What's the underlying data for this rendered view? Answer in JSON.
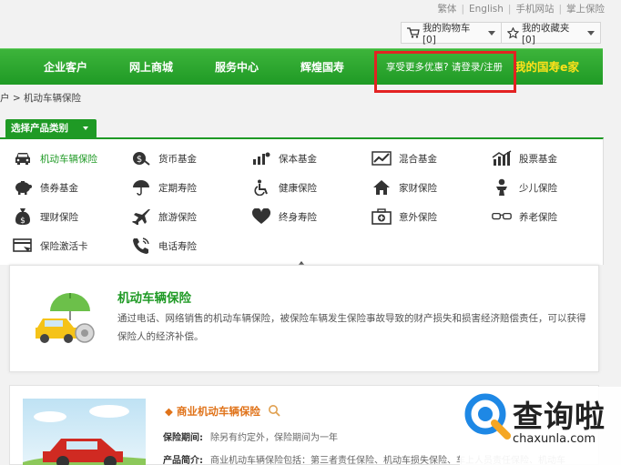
{
  "top_links": [
    "繁体",
    "English",
    "手机网站",
    "掌上保险"
  ],
  "cart": {
    "label": "我的购物车[0]"
  },
  "favorites": {
    "label": "我的收藏夹[0]"
  },
  "nav": {
    "items": [
      "企业客户",
      "网上商城",
      "服务中心",
      "辉煌国寿"
    ],
    "promo": "享受更多优惠? 请登录/注册",
    "brand": "我的国寿e家"
  },
  "breadcrumb": "户 > 机动车辆保险",
  "select_button": "选择产品类别",
  "categories": [
    {
      "label": "机动车辆保险",
      "icon": "car-icon"
    },
    {
      "label": "货币基金",
      "icon": "money-bag-icon"
    },
    {
      "label": "保本基金",
      "icon": "fund-chart-icon"
    },
    {
      "label": "混合基金",
      "icon": "trend-chart-icon"
    },
    {
      "label": "股票基金",
      "icon": "bar-chart-icon"
    },
    {
      "label": "债券基金",
      "icon": "piggy-bank-icon"
    },
    {
      "label": "定期寿险",
      "icon": "umbrella-icon"
    },
    {
      "label": "健康保险",
      "icon": "wheelchair-icon"
    },
    {
      "label": "家财保险",
      "icon": "house-icon"
    },
    {
      "label": "少儿保险",
      "icon": "baby-icon"
    },
    {
      "label": "理财保险",
      "icon": "dollar-bag-icon"
    },
    {
      "label": "旅游保险",
      "icon": "airplane-icon"
    },
    {
      "label": "终身寿险",
      "icon": "heart-icon"
    },
    {
      "label": "意外保险",
      "icon": "first-aid-icon"
    },
    {
      "label": "养老保险",
      "icon": "glasses-icon"
    },
    {
      "label": "保险激活卡",
      "icon": "card-icon"
    },
    {
      "label": "电话寿险",
      "icon": "phone-icon"
    }
  ],
  "detail": {
    "title": "机动车辆保险",
    "description": "通过电话、网络销售的机动车辆保险，被保险车辆发生保险事故导致的财产损失和损害经济赔偿责任，可以获得保险人的经济补偿。"
  },
  "product": {
    "title": "商业机动车辆保险",
    "period_label": "保险期间:",
    "period_value": "除另有约定外，保险期间为一年",
    "intro_label": "产品简介:",
    "intro_value": "商业机动车辆保险包括：第三者责任保险、机动车损失保险、车上人员责任保险、机动车"
  },
  "watermark": {
    "cn": "查询啦",
    "en": "chaxunla.com"
  },
  "colors": {
    "green": "#1f9a25",
    "red": "#e32222",
    "orange": "#e0731a",
    "yellow": "#ffe21a"
  }
}
